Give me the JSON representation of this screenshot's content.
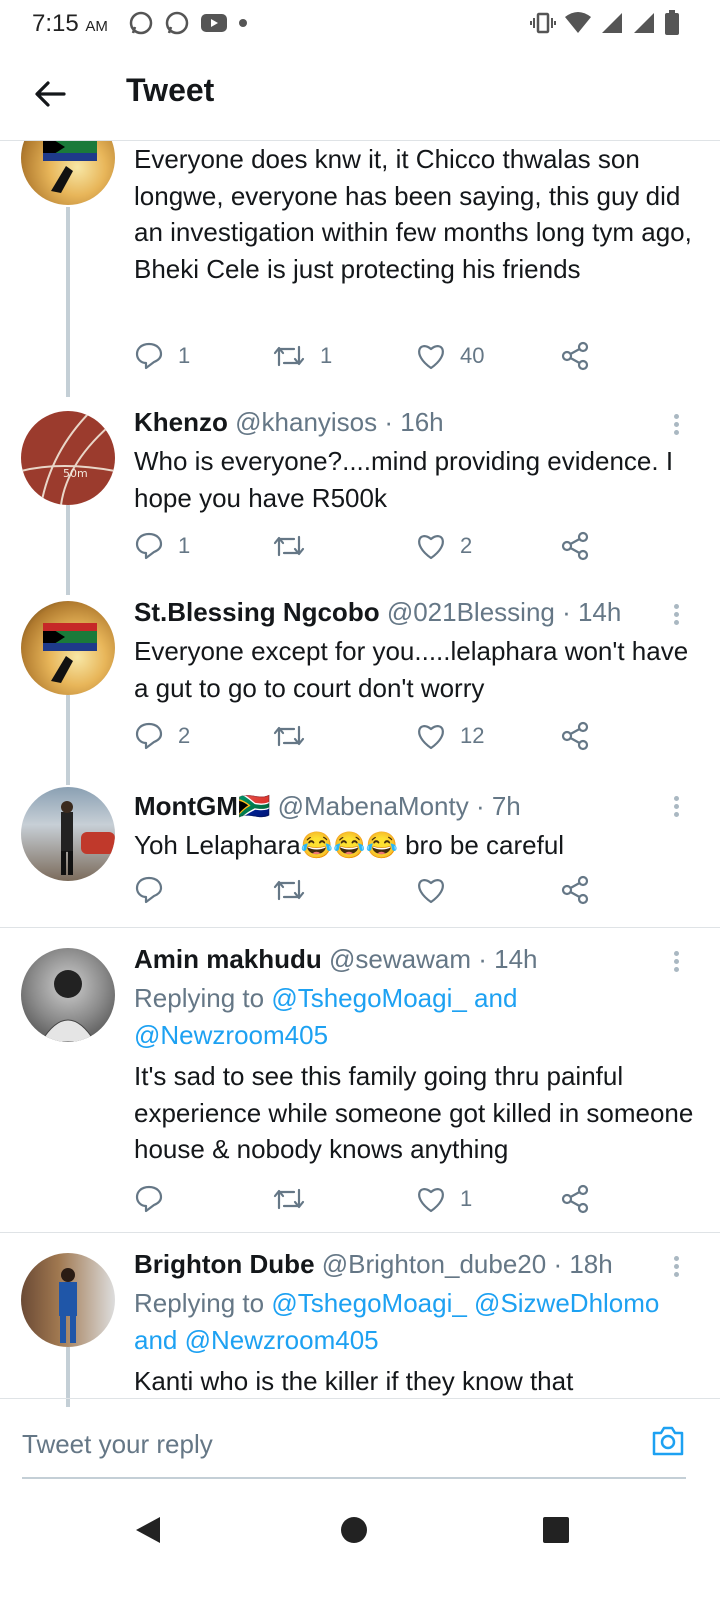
{
  "status_bar": {
    "time": "7:15",
    "ampm": "AM"
  },
  "header": {
    "title": "Tweet"
  },
  "tweets": [
    {
      "name": "",
      "handle": "",
      "time": "",
      "text": "Everyone does knw it, it Chicco thwalas son longwe, everyone has been saying, this guy did an investigation within few months long tym ago, Bheki Cele is just protecting his friends",
      "replies": "1",
      "retweets": "1",
      "likes": "40"
    },
    {
      "name": "Khenzo",
      "handle": "@khanyisos · 16h",
      "text": "Who is everyone?....mind providing evidence. I hope you have R500k",
      "replies": "1",
      "retweets": "",
      "likes": "2",
      "avatar_label": "50m"
    },
    {
      "name": "St.Blessing Ngcobo",
      "handle": "@021Blessing · 14h",
      "text": "Everyone except for you.....lelaphara won't have a gut to go to court don't worry",
      "replies": "2",
      "retweets": "",
      "likes": "12"
    },
    {
      "name": "MontGM🇿🇦",
      "handle": "@MabenaMonty · 7h",
      "text": "Yoh Lelaphara😂😂😂 bro be careful",
      "replies": "",
      "retweets": "",
      "likes": ""
    },
    {
      "name": "Amin makhudu",
      "handle": "@sewawam · 14h",
      "replying_prefix": "Replying to ",
      "replying_targets": "@TshegoMoagi_ and @Newzroom405",
      "text": "It's sad to see  this family going thru painful experience while someone got killed in someone house & nobody knows anything",
      "replies": "",
      "retweets": "",
      "likes": "1"
    },
    {
      "name": "Brighton Dube",
      "handle": "@Brighton_dube20 · 18h",
      "replying_prefix": "Replying to ",
      "replying_targets": "@TshegoMoagi_ @SizweDhlomo and @Newzroom405",
      "text": "Kanti who is the killer if they know that"
    }
  ],
  "composer": {
    "placeholder": "Tweet your reply"
  },
  "colors": {
    "accent": "#1da1f2",
    "secondary_text": "#657786",
    "divider": "#dfe3e6"
  },
  "icons": [
    "back-arrow-icon",
    "reply-icon",
    "retweet-icon",
    "like-icon",
    "share-icon",
    "more-icon",
    "camera-icon"
  ]
}
